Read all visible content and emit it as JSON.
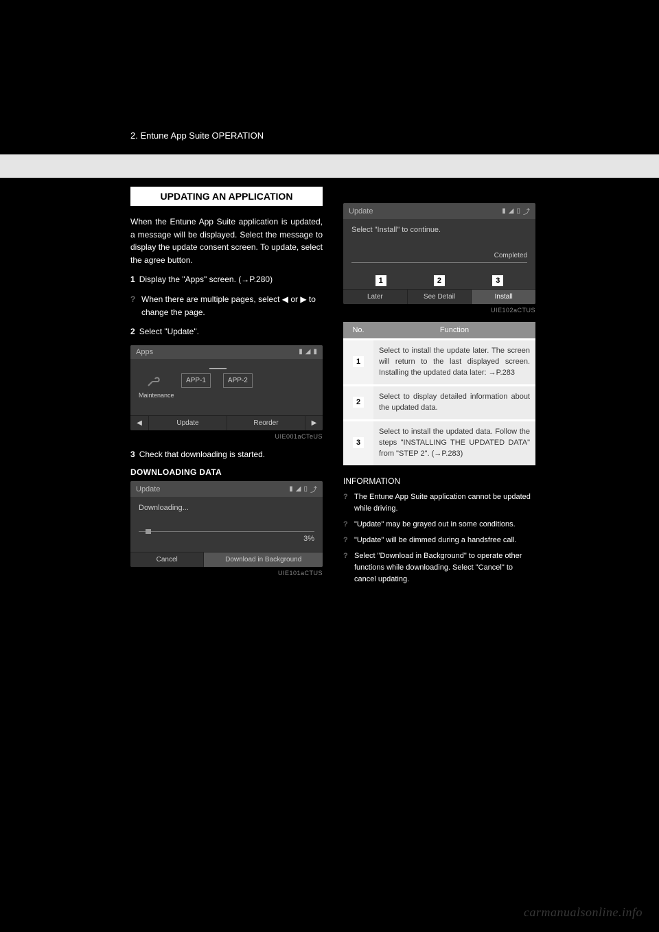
{
  "header": {
    "breadcrumb": "2. Entune App Suite OPERATION"
  },
  "left": {
    "section_title": "UPDATING AN APPLICATION",
    "intro": "When the Entune App Suite application is updated, a message will be displayed. Select the message to display the update consent screen. To update, select the agree button.",
    "step1_num": "1",
    "step1": "Display the \"Apps\" screen. (→P.280)",
    "bullet1": "When there are multiple pages, select ◀ or ▶ to change the page.",
    "step2_num": "2",
    "step2": "Select \"Update\".",
    "step3_num": "3",
    "step3": "Check that downloading is started.",
    "sub_download": "DOWNLOADING DATA",
    "sc1": {
      "title": "Apps",
      "maint_label": "Maintenance",
      "app1": "APP-1",
      "app2": "APP-2",
      "btn_left": "◀",
      "btn_update": "Update",
      "btn_reorder": "Reorder",
      "btn_right": "▶",
      "id": "UIE001aCTeUS"
    },
    "sc_update": {
      "title": "Update",
      "downloading": "Downloading...",
      "pct": "3%",
      "cancel": "Cancel",
      "bg": "Download in Background",
      "id": "UIE101aCTUS"
    }
  },
  "right": {
    "sc_install": {
      "title": "Update",
      "message": "Select \"Install\" to continue.",
      "completed": "Completed",
      "icon1": "1",
      "icon2": "2",
      "icon3": "3",
      "later": "Later",
      "seedetail": "See Detail",
      "install": "Install",
      "id": "UIE102aCTUS"
    },
    "table": {
      "hdr_no": "No.",
      "hdr_func": "Function",
      "r1_icon": "1",
      "r1": "Select to install the update later. The screen will return to the last displayed screen. Installing the updated data later: →P.283",
      "r2_icon": "2",
      "r2": "Select to display detailed information about the updated data.",
      "r3_icon": "3",
      "r3": "Select to install the updated data. Follow the steps \"INSTALLING THE UPDATED DATA\" from \"STEP 2\". (→P.283)"
    },
    "info_title": "INFORMATION",
    "info1": "The Entune App Suite application cannot be updated while driving.",
    "info2": "\"Update\" may be grayed out in some conditions.",
    "info3": "\"Update\" will be dimmed during a handsfree call.",
    "info4": "Select \"Download in Background\" to operate other functions while downloading. Select \"Cancel\" to cancel updating."
  },
  "watermark": "carmanualsonline.info"
}
